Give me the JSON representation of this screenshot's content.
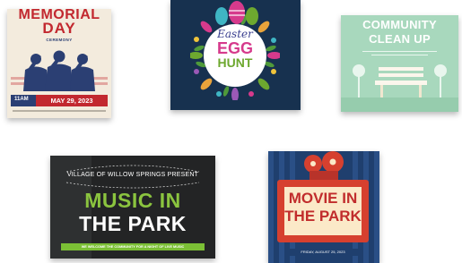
{
  "cards": [
    {
      "id": "memorial",
      "title_line1": "MEMORIAL",
      "title_line2": "DAY",
      "subtitle": "CEREMONY",
      "time": "11AM",
      "date": "MAY 29, 2023",
      "colors": {
        "red": "#c2282f",
        "navy": "#2b3f73",
        "cream": "#f3ebdd"
      }
    },
    {
      "id": "easter",
      "line1": "Easter",
      "line2": "EGG",
      "line3": "HUNT",
      "colors": {
        "bg": "#17314f",
        "pink": "#d63a8c",
        "green": "#6da82f"
      }
    },
    {
      "id": "cleanup",
      "line1": "COMMUNITY",
      "line2": "CLEAN UP",
      "colors": {
        "bg": "#a8d8bd"
      }
    },
    {
      "id": "music",
      "presenter": "VILLAGE OF WILLOW SPRINGS PRESENT",
      "line1": "MUSIC IN",
      "line2": "THE PARK",
      "banner": "WE WELCOME THE COMMUNITY FOR A NIGHT OF LIVE MUSIC",
      "colors": {
        "bg": "#232425",
        "green": "#8bc43f"
      }
    },
    {
      "id": "movie",
      "line1": "MOVIE IN",
      "line2": "THE PARK",
      "date": "FRIDAY, AUGUST 25, 2023",
      "colors": {
        "bg": "#1f3f6e",
        "red": "#d6402f",
        "cream": "#fbe9c8"
      }
    }
  ]
}
